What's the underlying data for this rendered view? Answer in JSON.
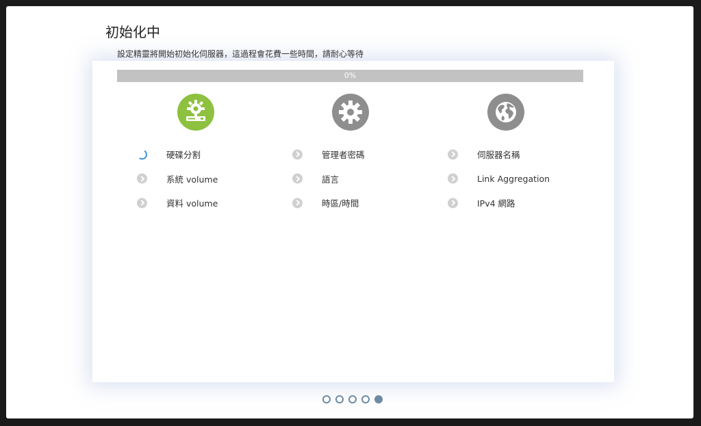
{
  "wizard": {
    "title": "初始化中",
    "description": "設定精靈將開始初始化伺服器，這過程會花費一些時間，請耐心等待",
    "progress": {
      "value": 0,
      "label": "0%"
    }
  },
  "columns": [
    {
      "icon": "disk-gear-icon",
      "icon_color": "#8dc13f",
      "steps": [
        {
          "label": "硬碟分割",
          "status": "in-progress"
        },
        {
          "label": "系統 volume",
          "status": "pending"
        },
        {
          "label": "資料 volume",
          "status": "pending"
        }
      ]
    },
    {
      "icon": "gear-icon",
      "icon_color": "#8e8e8e",
      "steps": [
        {
          "label": "管理者密碼",
          "status": "pending"
        },
        {
          "label": "語言",
          "status": "pending"
        },
        {
          "label": "時區/時間",
          "status": "pending"
        }
      ]
    },
    {
      "icon": "globe-icon",
      "icon_color": "#8e8e8e",
      "steps": [
        {
          "label": "伺服器名稱",
          "status": "pending"
        },
        {
          "label": "Link Aggregation",
          "status": "pending"
        },
        {
          "label": "IPv4 網路",
          "status": "pending"
        }
      ]
    }
  ],
  "pagination": {
    "total": 5,
    "current": 5
  },
  "colors": {
    "accent_green": "#8dc13f",
    "inactive_gray": "#8e8e8e",
    "progress_track": "#c2c2c2",
    "dot_color": "#6d8aa3"
  }
}
